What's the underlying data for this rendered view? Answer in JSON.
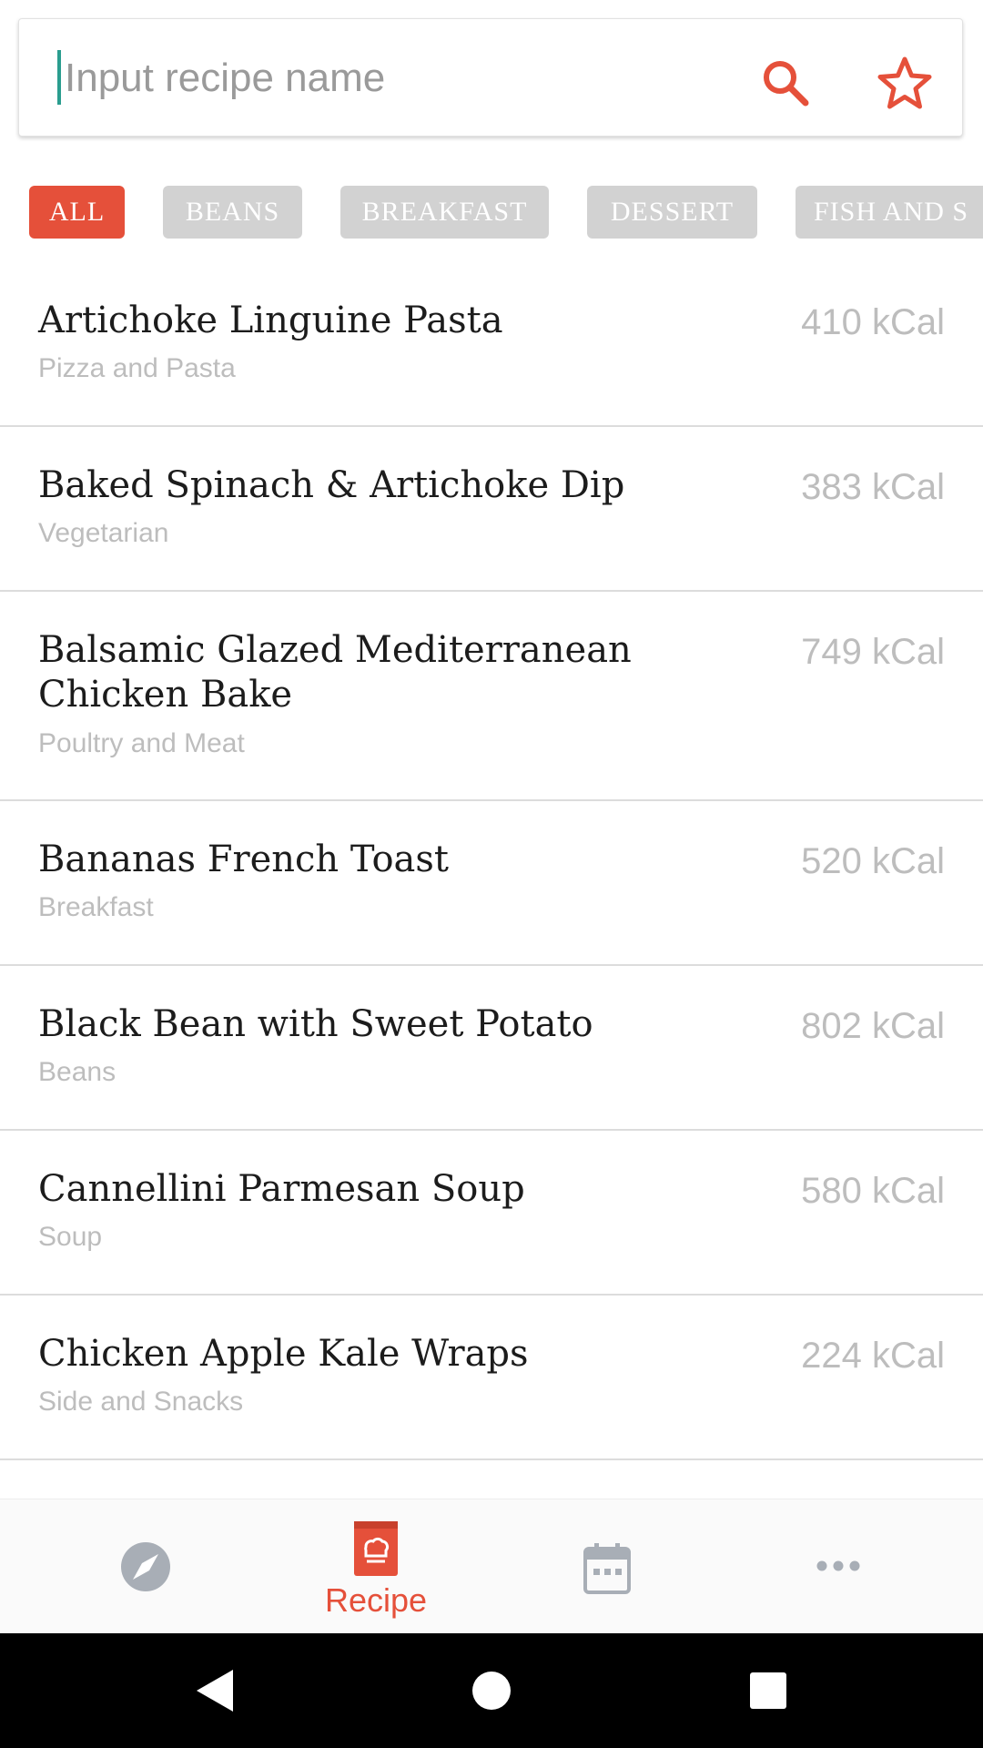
{
  "search": {
    "placeholder": "Input recipe name",
    "value": ""
  },
  "icons": {
    "search": "search-icon",
    "favorite": "star-icon",
    "discover": "compass-icon",
    "recipe": "recipe-book-icon",
    "calendar": "calendar-icon",
    "more": "more-dots-icon"
  },
  "colors": {
    "accent": "#e5503a",
    "chip_inactive": "#d2d2d2",
    "muted_text": "#bdbdbd",
    "nav_icon": "#a8aeb6"
  },
  "categories": [
    {
      "label": "ALL",
      "active": true
    },
    {
      "label": "BEANS",
      "active": false
    },
    {
      "label": "BREAKFAST",
      "active": false
    },
    {
      "label": "DESSERT",
      "active": false
    },
    {
      "label": "FISH AND S",
      "active": false
    }
  ],
  "recipes": [
    {
      "title": "Artichoke Linguine Pasta",
      "category": "Pizza and Pasta",
      "kcal": "410 kCal"
    },
    {
      "title": "Baked Spinach & Artichoke Dip",
      "category": "Vegetarian",
      "kcal": "383 kCal"
    },
    {
      "title": "Balsamic Glazed Mediterranean Chicken Bake",
      "category": "Poultry and Meat",
      "kcal": "749 kCal"
    },
    {
      "title": "Bananas French Toast",
      "category": "Breakfast",
      "kcal": "520 kCal"
    },
    {
      "title": "Black Bean with Sweet Potato",
      "category": "Beans",
      "kcal": "802 kCal"
    },
    {
      "title": "Cannellini Parmesan Soup",
      "category": "Soup",
      "kcal": "580 kCal"
    },
    {
      "title": "Chicken Apple Kale Wraps",
      "category": "Side and Snacks",
      "kcal": "224 kCal"
    }
  ],
  "bottom_nav": {
    "active_label": "Recipe"
  }
}
